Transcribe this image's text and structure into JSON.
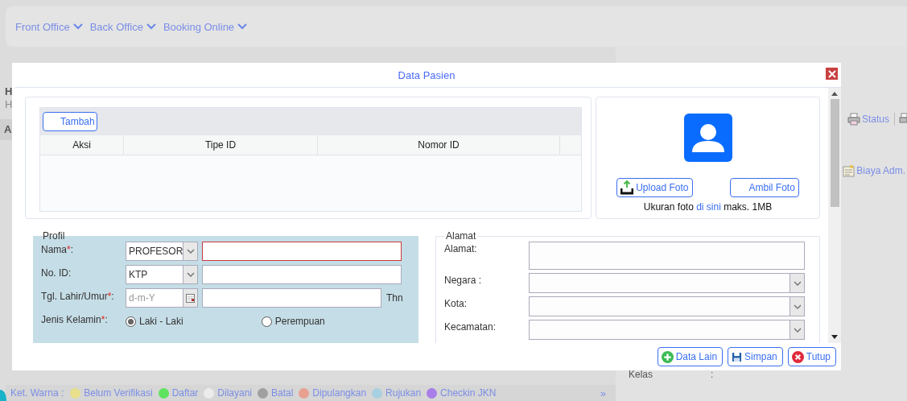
{
  "navbar": {
    "menus": [
      {
        "label": "Front Office"
      },
      {
        "label": "Back Office"
      },
      {
        "label": "Booking Online"
      }
    ]
  },
  "background": {
    "left_fragments": [
      "H",
      "H",
      "A"
    ],
    "toolbar": [
      {
        "label": "Status"
      }
    ],
    "side_items": [
      {
        "label": "Biaya Adm."
      }
    ],
    "kelas": {
      "label": "Kelas",
      "value": ":"
    }
  },
  "dialog": {
    "title": "Data Pasien",
    "id_table": {
      "add_button": "Tambah",
      "columns": [
        "Aksi",
        "Tipe ID",
        "Nomor ID"
      ]
    },
    "photo": {
      "buttons": [
        {
          "kind": "upload",
          "label": "Upload Foto"
        },
        {
          "kind": "camera",
          "label": "Ambil Foto"
        }
      ],
      "note_prefix": "Ukuran foto",
      "note_link": "di sini",
      "note_suffix": "maks. 1MB"
    },
    "profil": {
      "legend": "Profil",
      "rows": [
        {
          "kind": "select-input",
          "label": "Nama",
          "required_mark": "*",
          "colon": ":",
          "select": "PROFESOR",
          "invalid": true
        },
        {
          "kind": "select-input",
          "label": "No. ID:",
          "select": "KTP",
          "invalid": false
        },
        {
          "kind": "date-age",
          "label": "Tgl. Lahir/Umur",
          "required_mark": "*",
          "colon": ":",
          "placeholder": "d-m-Y",
          "unit": "Thn"
        },
        {
          "kind": "radio",
          "label": "Jenis Kelamin",
          "required_mark": "*",
          "colon": ":",
          "options": [
            {
              "label": "Laki - Laki",
              "selected": true
            },
            {
              "label": "Perempuan",
              "selected": false
            }
          ]
        }
      ]
    },
    "alamat": {
      "legend": "Alamat",
      "rows": [
        {
          "kind": "textarea",
          "label": "Alamat:"
        },
        {
          "kind": "select",
          "label": "Negara :"
        },
        {
          "kind": "select",
          "label": "Kota:"
        },
        {
          "kind": "select",
          "label": "Kecamatan:"
        }
      ]
    },
    "footer_buttons": [
      {
        "kind": "add",
        "label": "Data Lain"
      },
      {
        "kind": "save",
        "label": "Simpan"
      },
      {
        "kind": "close",
        "label": "Tutup"
      }
    ]
  },
  "legend": {
    "title": "Ket. Warna :",
    "items": [
      {
        "label": "Belum Verifikasi",
        "color": "#e8e08a"
      },
      {
        "label": "Daftar",
        "color": "#5fe35f"
      },
      {
        "label": "Dilayani",
        "color": "#ececec"
      },
      {
        "label": "Batal",
        "color": "#a0a0a0"
      },
      {
        "label": "Dipulangkan",
        "color": "#e8a090"
      },
      {
        "label": "Rujukan",
        "color": "#a8d0e0"
      },
      {
        "label": "Checkin JKN",
        "color": "#a87ee8"
      }
    ],
    "more": "»"
  }
}
